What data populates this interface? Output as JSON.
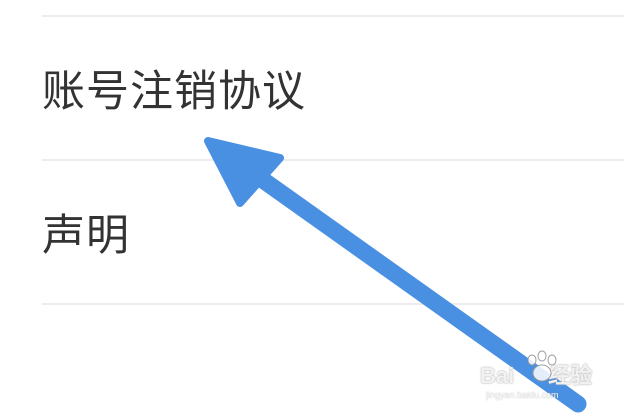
{
  "menu": {
    "items": [
      {
        "label": "账号注销协议"
      },
      {
        "label": "声明"
      }
    ]
  },
  "watermark": {
    "brand": "Bai",
    "brand_tail": "经验",
    "domain": "jingyan.baidu.com"
  },
  "annotation": {
    "arrow_color": "#4a90e2",
    "arrow_icon": "pointer-arrow-icon"
  }
}
